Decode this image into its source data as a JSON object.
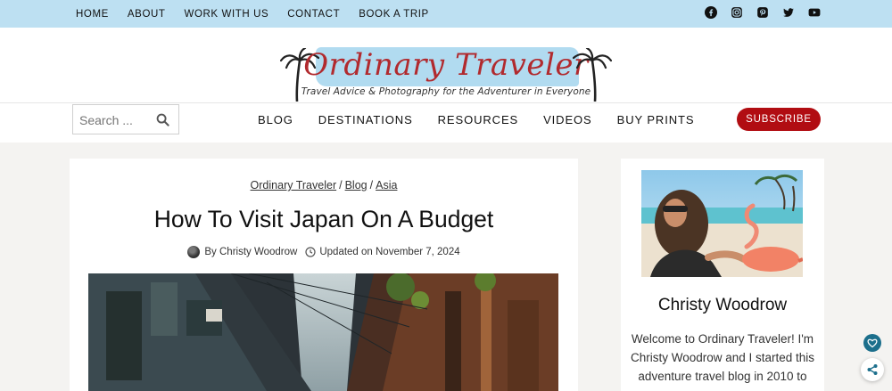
{
  "top_nav": {
    "items": [
      "HOME",
      "ABOUT",
      "WORK WITH US",
      "CONTACT",
      "BOOK A TRIP"
    ]
  },
  "social": {
    "icons": [
      "facebook-icon",
      "instagram-icon",
      "pinterest-icon",
      "twitter-icon",
      "youtube-icon"
    ]
  },
  "logo": {
    "title": "Ordinary Traveler",
    "tagline": "Travel Advice & Photography for the Adventurer in Everyone"
  },
  "search": {
    "placeholder": "Search ..."
  },
  "main_nav": {
    "items": [
      "BLOG",
      "DESTINATIONS",
      "RESOURCES",
      "VIDEOS",
      "BUY PRINTS"
    ]
  },
  "subscribe": {
    "label": "SUBSCRIBE"
  },
  "article": {
    "breadcrumbs": [
      "Ordinary Traveler",
      "Blog",
      "Asia"
    ],
    "title": "How To Visit Japan On A Budget",
    "author": "By Christy Woodrow",
    "updated": "Updated on November 7, 2024"
  },
  "sidebar": {
    "name": "Christy Woodrow",
    "bio": "Welcome to Ordinary Traveler! I'm Christy Woodrow and I started this adventure travel blog in 2010 to"
  },
  "colors": {
    "topbar": "#bde0f2",
    "brand_red": "#b10d12",
    "heart_badge": "#1c6f8c"
  }
}
